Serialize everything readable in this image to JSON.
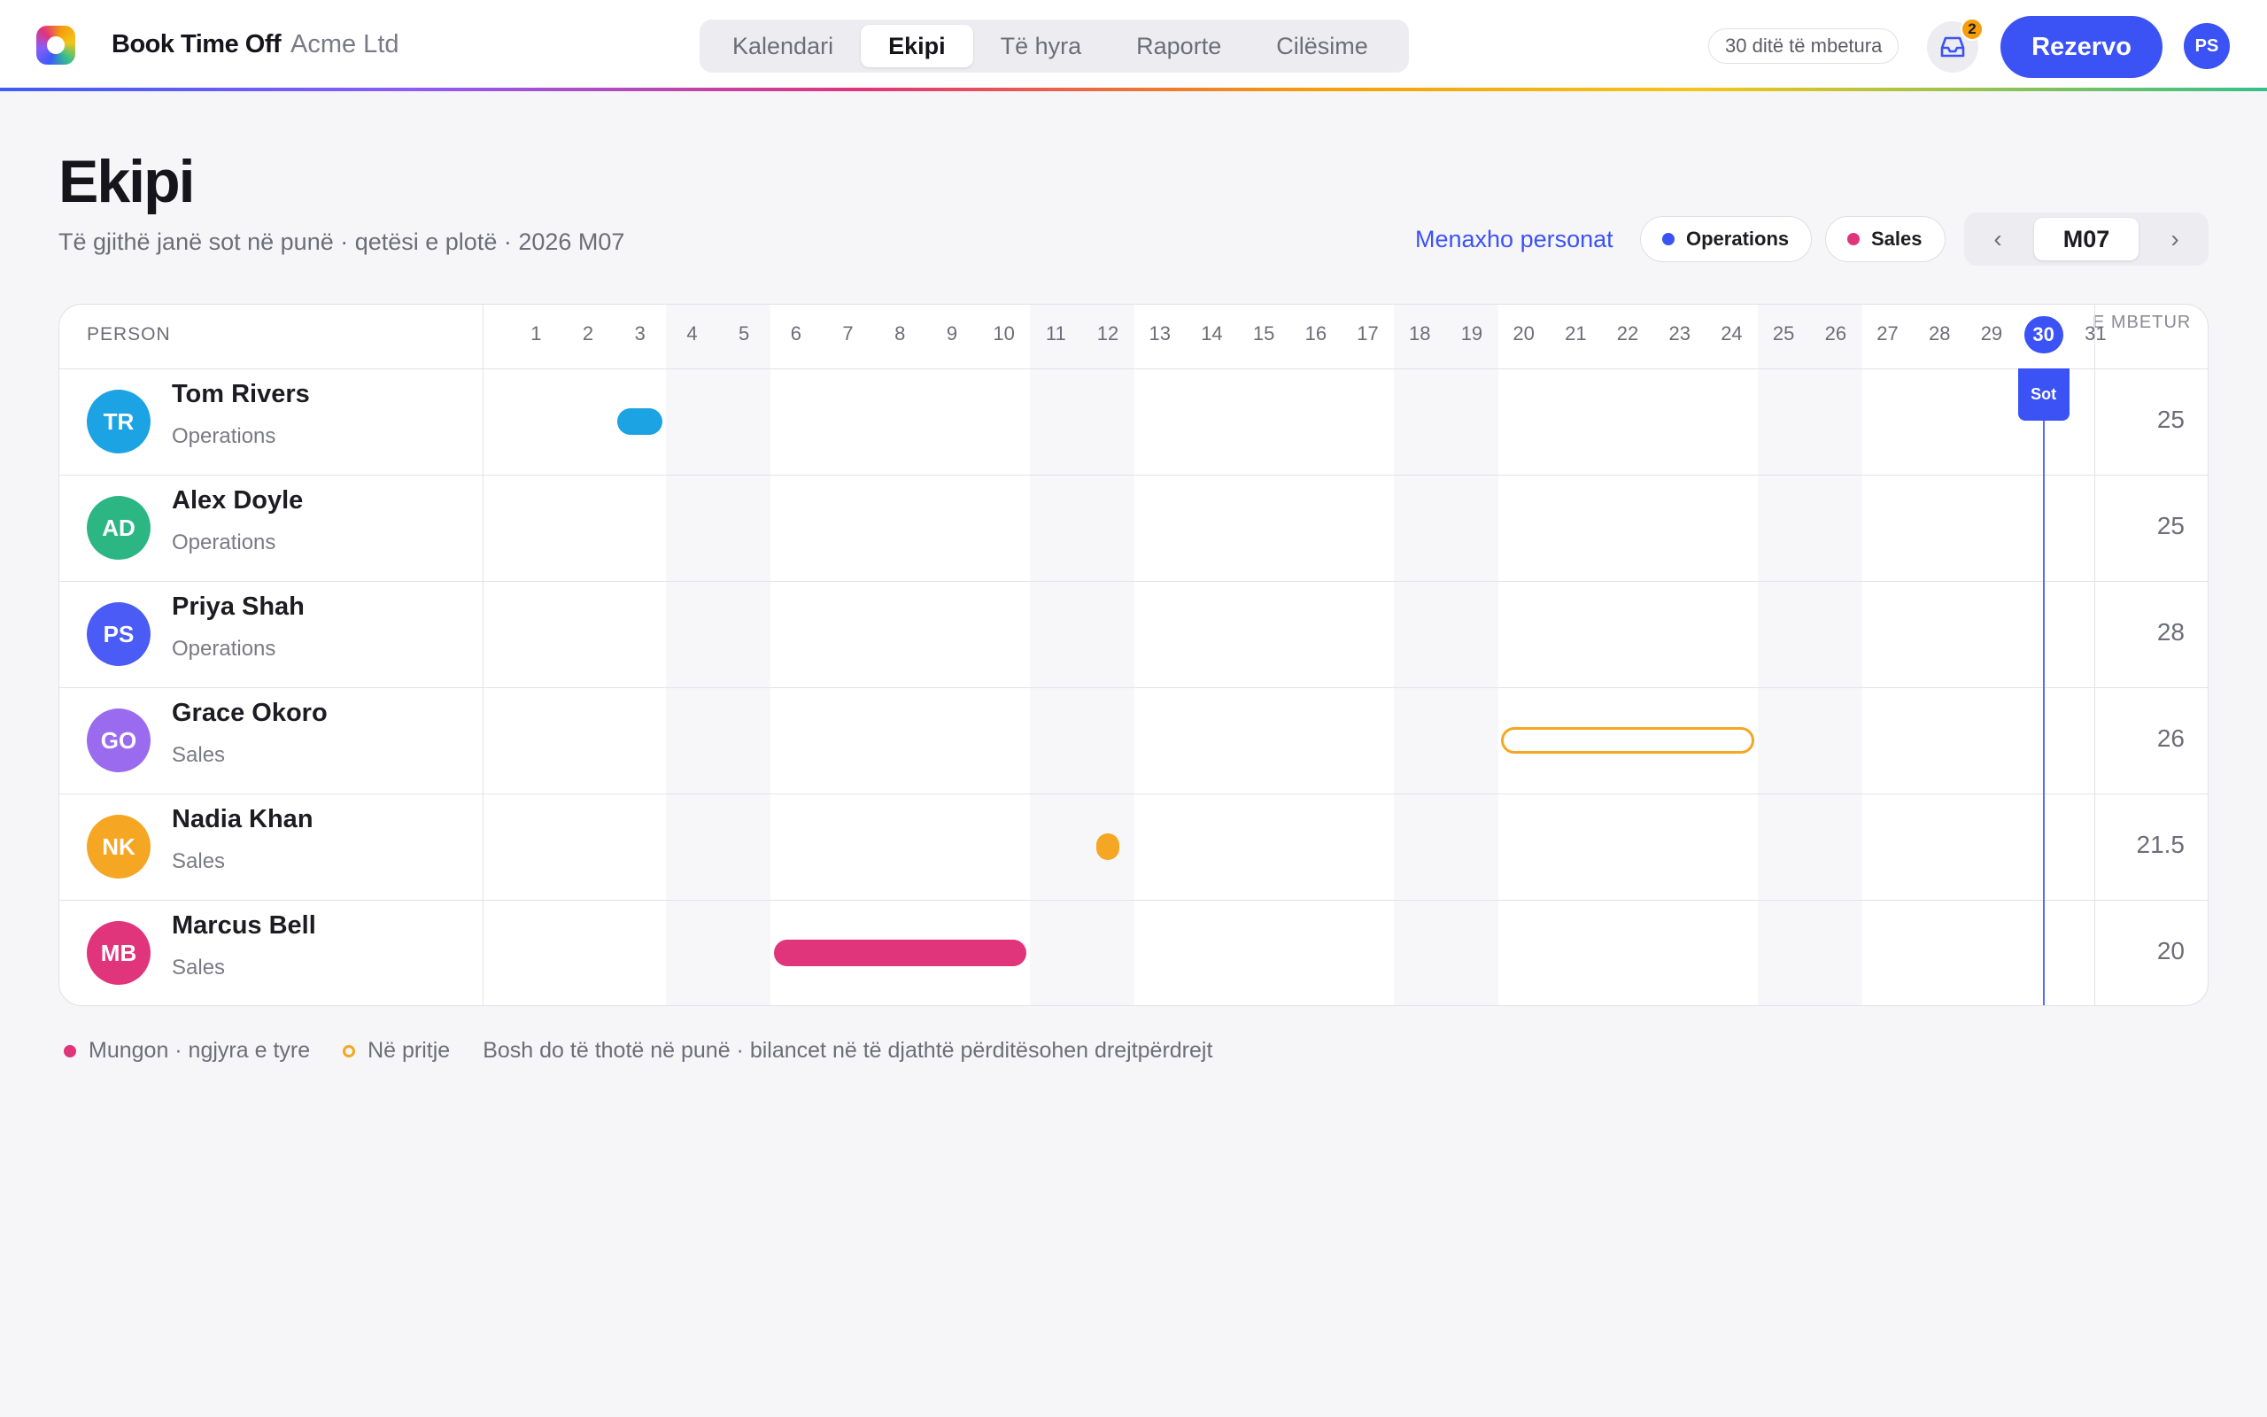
{
  "app": {
    "name": "Book Time Off",
    "company": "Acme Ltd"
  },
  "nav": {
    "tabs": [
      {
        "label": "Kalendari",
        "active": false
      },
      {
        "label": "Ekipi",
        "active": true
      },
      {
        "label": "Të hyra",
        "active": false
      },
      {
        "label": "Raporte",
        "active": false
      },
      {
        "label": "Cilësime",
        "active": false
      }
    ]
  },
  "header": {
    "remaining_days": "30 ditë të mbetura",
    "inbox_count": "2",
    "book_label": "Rezervo",
    "user_initials": "PS",
    "accent": "#3b52f5"
  },
  "page": {
    "title": "Ekipi",
    "subtitle": "Të gjithë janë sot në punë · qetësi e plotë · 2026 M07",
    "manage_link": "Menaxho personat"
  },
  "filters": [
    {
      "label": "Operations",
      "color": "#3b52f5"
    },
    {
      "label": "Sales",
      "color": "#e0347b"
    }
  ],
  "month": {
    "prev": "‹",
    "label": "M07",
    "next": "›"
  },
  "grid": {
    "person_header": "PERSON",
    "remaining_header": "E MBETUR",
    "today_label": "Sot",
    "today_day": 30,
    "days": [
      1,
      2,
      3,
      4,
      5,
      6,
      7,
      8,
      9,
      10,
      11,
      12,
      13,
      14,
      15,
      16,
      17,
      18,
      19,
      20,
      21,
      22,
      23,
      24,
      25,
      26,
      27,
      28,
      29,
      30,
      31
    ],
    "weekend_days": [
      4,
      5,
      11,
      12,
      18,
      19,
      25,
      26
    ],
    "people": [
      {
        "initials": "TR",
        "name": "Tom Rivers",
        "team": "Operations",
        "remaining": "25",
        "color": "#1ba3e3",
        "absences": [
          {
            "start": 3,
            "end": 3,
            "status": "approved",
            "color": "#1ba3e3"
          }
        ]
      },
      {
        "initials": "AD",
        "name": "Alex Doyle",
        "team": "Operations",
        "remaining": "25",
        "color": "#2bb683",
        "absences": []
      },
      {
        "initials": "PS",
        "name": "Priya Shah",
        "team": "Operations",
        "remaining": "28",
        "color": "#4a5cf5",
        "absences": []
      },
      {
        "initials": "GO",
        "name": "Grace Okoro",
        "team": "Sales",
        "remaining": "26",
        "color": "#9a6bef",
        "absences": [
          {
            "start": 20,
            "end": 24,
            "status": "pending",
            "color": "#f5a623"
          }
        ]
      },
      {
        "initials": "NK",
        "name": "Nadia Khan",
        "team": "Sales",
        "remaining": "21.5",
        "color": "#f5a623",
        "absences": [
          {
            "start": 12,
            "end": 12,
            "half": true,
            "status": "approved",
            "color": "#f5a623"
          }
        ]
      },
      {
        "initials": "MB",
        "name": "Marcus Bell",
        "team": "Sales",
        "remaining": "20",
        "color": "#e0347b",
        "absences": [
          {
            "start": 6,
            "end": 10,
            "status": "approved",
            "color": "#e0347b"
          }
        ]
      }
    ]
  },
  "legend": {
    "absent": "Mungon · ngjyra e tyre",
    "absent_color": "#e0347b",
    "pending": "Në pritje",
    "note": "Bosh do të thotë në punë · bilancet në të djathtë përditësohen drejtpërdrejt"
  }
}
